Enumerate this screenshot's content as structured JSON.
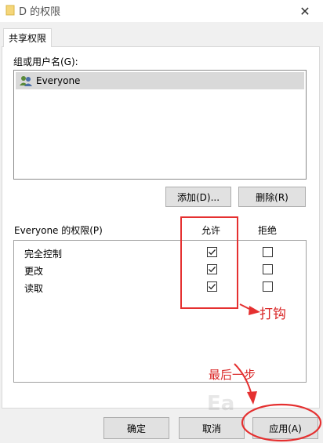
{
  "window": {
    "title": "D 的权限",
    "close_glyph": "✕"
  },
  "tab": {
    "label": "共享权限"
  },
  "group_section": {
    "label": "组或用户名(G):",
    "users": [
      {
        "name": "Everyone",
        "icon": "users-icon"
      }
    ]
  },
  "buttons": {
    "add": "添加(D)...",
    "remove": "删除(R)",
    "ok": "确定",
    "cancel": "取消",
    "apply": "应用(A)"
  },
  "permissions": {
    "header": "Everyone 的权限(P)",
    "col_allow": "允许",
    "col_deny": "拒绝",
    "rows": [
      {
        "name": "完全控制",
        "allow": true,
        "deny": false
      },
      {
        "name": "更改",
        "allow": true,
        "deny": false
      },
      {
        "name": "读取",
        "allow": true,
        "deny": false
      }
    ]
  },
  "annotations": {
    "check_label": "打钩",
    "last_step_label": "最后一步",
    "color": "#e53030"
  },
  "watermark": {
    "text": "Ea"
  }
}
